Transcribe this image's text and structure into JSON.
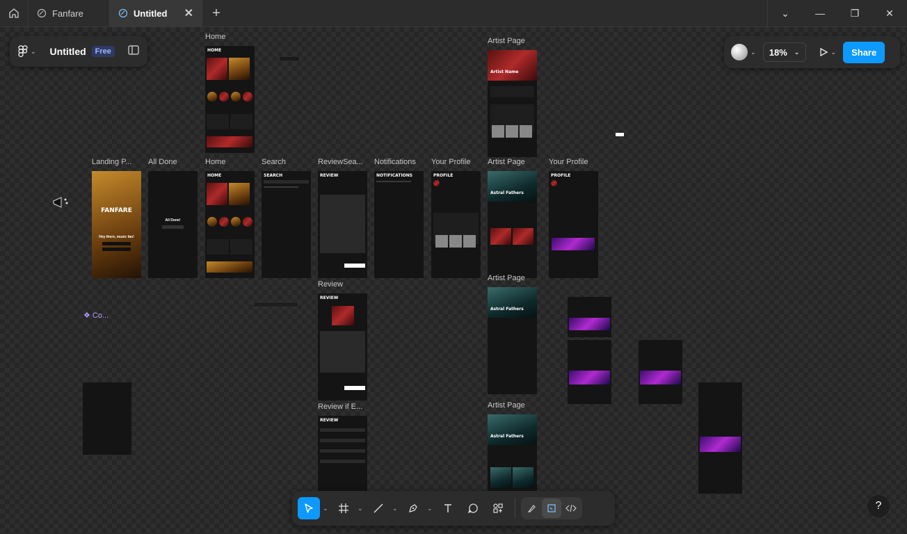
{
  "tabs": [
    {
      "label": "Fanfare",
      "active": false
    },
    {
      "label": "Untitled",
      "active": true
    }
  ],
  "file": {
    "title": "Untitled",
    "plan": "Free"
  },
  "zoom": "18%",
  "share_label": "Share",
  "help_label": "?",
  "frames": {
    "home_top": "Home",
    "artist_top": "Artist Page",
    "landing": "Landing P...",
    "all_done": "All Done",
    "home": "Home",
    "search": "Search",
    "review_search": "ReviewSea...",
    "notifications": "Notifications",
    "your_profile_1": "Your Profile",
    "artist_mid": "Artist Page",
    "your_profile_2": "Your Profile",
    "review": "Review",
    "artist_lower": "Artist Page",
    "review_if": "Review if E...",
    "artist_bottom": "Artist Page",
    "component": "❖ Co..."
  },
  "screens": {
    "home_header": "HOME",
    "search_header": "SEARCH",
    "review_header": "REVIEW",
    "notifications_header": "NOTIFICATIONS",
    "profile_header": "PROFILE",
    "fanfare_brand": "FANFARE",
    "greeting": "Hey there, music fan!",
    "all_done_title": "All Done!",
    "artist_name": "Astral Fathers",
    "artist_placeholder": "Artist Name"
  }
}
